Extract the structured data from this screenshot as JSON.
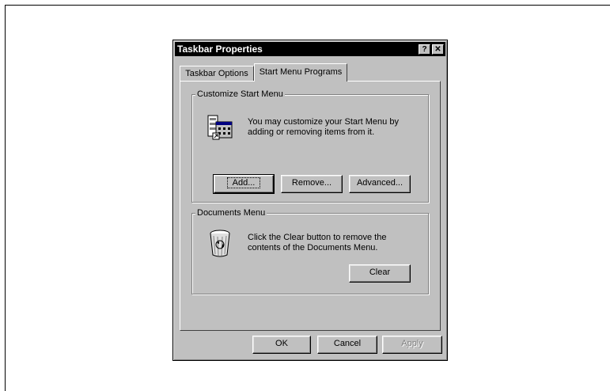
{
  "dialog": {
    "title": "Taskbar Properties",
    "help_button": "?",
    "close_button": "✕"
  },
  "tabs": [
    {
      "label": "Taskbar Options",
      "active": false
    },
    {
      "label": "Start Menu Programs",
      "active": true
    }
  ],
  "customize_group": {
    "legend": "Customize Start Menu",
    "description_line1": "You may customize your Start Menu by",
    "description_line2": "adding or removing items from it.",
    "icon": "start-menu-icon",
    "buttons": {
      "add": "Add...",
      "remove": "Remove...",
      "advanced": "Advanced..."
    }
  },
  "documents_group": {
    "legend": "Documents Menu",
    "description_line1": "Click the Clear button to remove the",
    "description_line2": "contents of the Documents Menu.",
    "icon": "recycle-bin-icon",
    "clear_button": "Clear"
  },
  "footer": {
    "ok": "OK",
    "cancel": "Cancel",
    "apply": "Apply"
  }
}
